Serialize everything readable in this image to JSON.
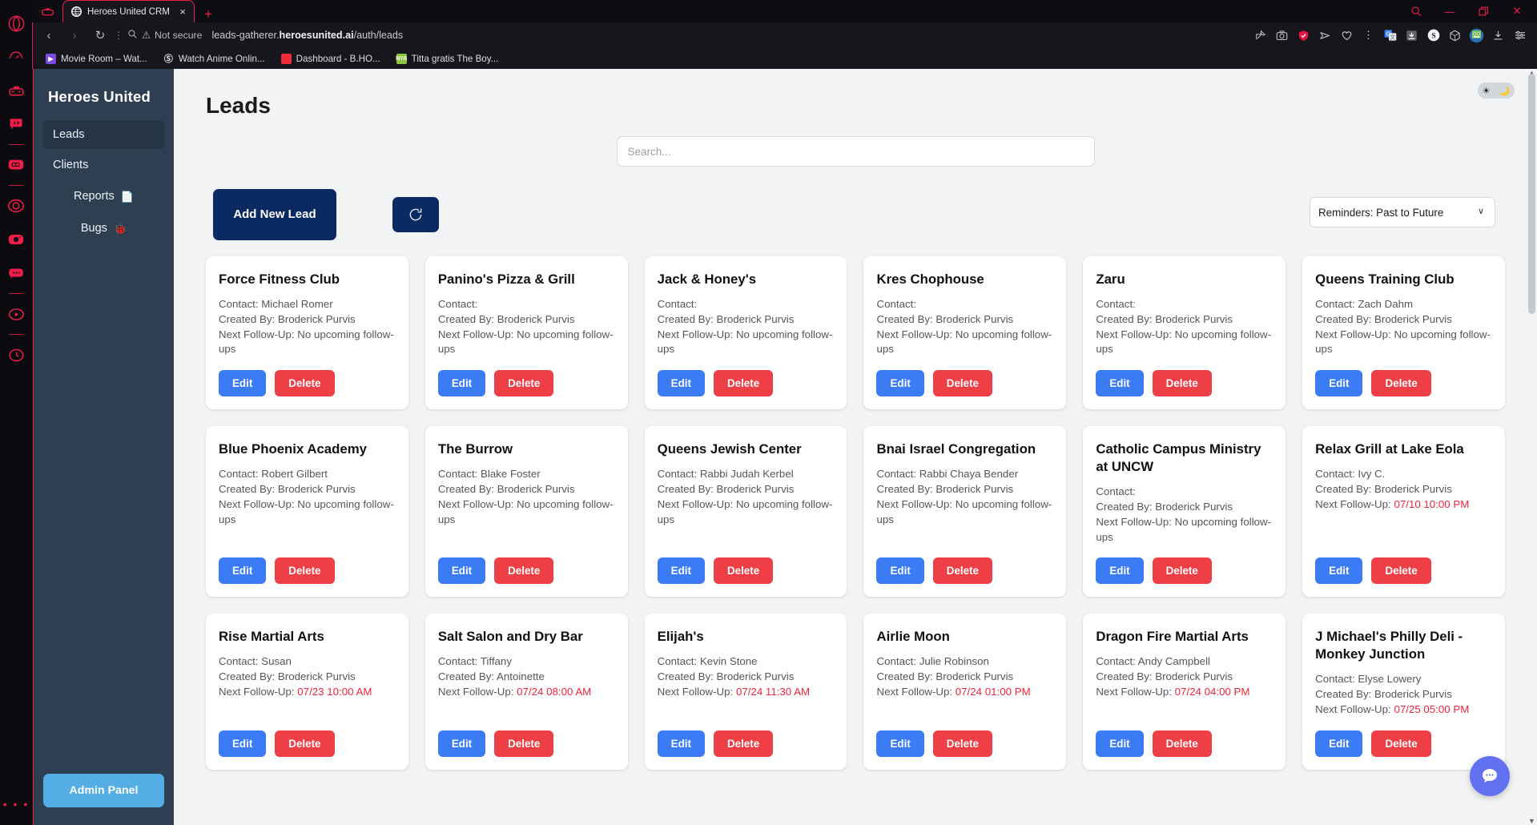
{
  "browser": {
    "tab": {
      "title": "Heroes United CRM",
      "favicon": "globe-icon",
      "close": "×"
    },
    "new_tab": "+",
    "window_controls": {
      "search": "⌕",
      "minimize": "—",
      "restore": "❐",
      "close": "✕"
    },
    "nav": {
      "back": "‹",
      "forward": "›",
      "reload": "↻",
      "vdots": "⋮"
    },
    "security": {
      "label": "Not secure",
      "warn_icon": "⚠",
      "magnifier_icon": "⌕"
    },
    "url": {
      "prefix": "leads-gatherer.",
      "domain": "heroesunited.ai",
      "path": "/auth/leads"
    },
    "toolbar_icons": [
      {
        "name": "pin-edit-icon",
        "glyph": "✎"
      },
      {
        "name": "camera-icon",
        "glyph": "▢"
      },
      {
        "name": "shield-check-icon",
        "glyph": "✔"
      },
      {
        "name": "send-icon",
        "glyph": "➤"
      },
      {
        "name": "heart-icon",
        "glyph": "♡"
      },
      {
        "name": "vertical-dots-icon",
        "glyph": "⋮"
      },
      {
        "name": "google-translate-icon",
        "glyph": "G"
      },
      {
        "name": "download-arrow-icon",
        "glyph": "⬇"
      },
      {
        "name": "shopify-icon",
        "glyph": "S"
      },
      {
        "name": "cube-icon",
        "glyph": "⬡"
      },
      {
        "name": "profile-avatar-icon",
        "glyph": ""
      },
      {
        "name": "downloads-icon",
        "glyph": "⤓"
      },
      {
        "name": "easy-setup-icon",
        "glyph": "☰"
      }
    ],
    "bookmarks": [
      {
        "label": "Movie Room – Wat...",
        "icon": "play-icon",
        "color": "#7b4ae0"
      },
      {
        "label": "Watch Anime Onlin...",
        "icon": "aniwave-icon",
        "color": "#1b1b22"
      },
      {
        "label": "Dashboard - B.HO...",
        "icon": "square-icon",
        "color": "#ee2b39"
      },
      {
        "label": "Titta gratis The Boy...",
        "icon": "nya-icon",
        "color": "#8cc63f"
      }
    ],
    "opera_rail": [
      {
        "name": "opera-logo-icon"
      },
      {
        "name": "speed-dial-icon"
      },
      {
        "name": "gamepad-icon"
      },
      {
        "name": "twitch-icon"
      },
      {
        "name": "separator"
      },
      {
        "name": "chatgpt-icon"
      },
      {
        "name": "separator"
      },
      {
        "name": "whatsapp-icon"
      },
      {
        "name": "instagram-icon"
      },
      {
        "name": "messenger-icon"
      },
      {
        "name": "separator"
      },
      {
        "name": "video-player-icon"
      },
      {
        "name": "separator"
      },
      {
        "name": "history-clock-icon"
      }
    ],
    "rail_more": "• • •"
  },
  "app": {
    "brand": "Heroes United",
    "sidebar": {
      "items": [
        {
          "label": "Leads",
          "icon": "",
          "active": true
        },
        {
          "label": "Clients",
          "icon": "",
          "active": false
        },
        {
          "label": "Reports",
          "icon": "📄",
          "active": false
        },
        {
          "label": "Bugs",
          "icon": "🐞",
          "active": false
        }
      ],
      "admin_button": "Admin Panel"
    },
    "theme_toggle": {
      "light_icon": "☀",
      "dark_icon": "🌙"
    },
    "page_title": "Leads",
    "search": {
      "placeholder": "Search...",
      "value": ""
    },
    "add_lead_label": "Add New Lead",
    "refresh_icon": "↺",
    "sort_select": {
      "selected": "Reminders: Past to Future",
      "caret": "∨",
      "options": [
        "Reminders: Past to Future"
      ]
    },
    "labels": {
      "contact": "Contact:",
      "created_by": "Created By:",
      "next_follow_up": "Next Follow-Up:",
      "no_followups": "No upcoming follow-ups",
      "edit": "Edit",
      "delete": "Delete"
    },
    "chat_fab_icon": "💬",
    "colors": {
      "sidebar_bg": "#2e3f52",
      "admin_btn": "#55ade5",
      "primary_dark": "#0b2a62",
      "edit_blue": "#3b7cf6",
      "delete_red": "#ef3f46",
      "followup_red": "#f0243c",
      "opera_accent": "#f01d4b"
    },
    "leads": [
      {
        "name": "Force Fitness Club",
        "contact": "Michael Romer",
        "created_by": "Broderick Purvis",
        "follow_up": "No upcoming follow-ups",
        "urgent": false
      },
      {
        "name": "Panino's Pizza & Grill",
        "contact": "",
        "created_by": "Broderick Purvis",
        "follow_up": "No upcoming follow-ups",
        "urgent": false
      },
      {
        "name": "Jack & Honey's",
        "contact": "",
        "created_by": "Broderick Purvis",
        "follow_up": "No upcoming follow-ups",
        "urgent": false
      },
      {
        "name": "Kres Chophouse",
        "contact": "",
        "created_by": "Broderick Purvis",
        "follow_up": "No upcoming follow-ups",
        "urgent": false
      },
      {
        "name": "Zaru",
        "contact": "",
        "created_by": "Broderick Purvis",
        "follow_up": "No upcoming follow-ups",
        "urgent": false
      },
      {
        "name": "Queens Training Club",
        "contact": "Zach Dahm",
        "created_by": "Broderick Purvis",
        "follow_up": "No upcoming follow-ups",
        "urgent": false
      },
      {
        "name": "Blue Phoenix Academy",
        "contact": "Robert Gilbert",
        "created_by": "Broderick Purvis",
        "follow_up": "No upcoming follow-ups",
        "urgent": false
      },
      {
        "name": "The Burrow",
        "contact": "Blake Foster",
        "created_by": "Broderick Purvis",
        "follow_up": "No upcoming follow-ups",
        "urgent": false
      },
      {
        "name": "Queens Jewish Center",
        "contact": "Rabbi Judah Kerbel",
        "created_by": "Broderick Purvis",
        "follow_up": "No upcoming follow-ups",
        "urgent": false
      },
      {
        "name": "Bnai Israel Congregation",
        "contact": "Rabbi Chaya Bender",
        "created_by": "Broderick Purvis",
        "follow_up": "No upcoming follow-ups",
        "urgent": false
      },
      {
        "name": "Catholic Campus Ministry at UNCW",
        "contact": "",
        "created_by": "Broderick Purvis",
        "follow_up": "No upcoming follow-ups",
        "urgent": false
      },
      {
        "name": "Relax Grill at Lake Eola",
        "contact": "Ivy C.",
        "created_by": "Broderick Purvis",
        "follow_up": "07/10 10:00 PM",
        "urgent": true
      },
      {
        "name": "Rise Martial Arts",
        "contact": "Susan",
        "created_by": "Broderick Purvis",
        "follow_up": "07/23 10:00 AM",
        "urgent": true
      },
      {
        "name": "Salt Salon and Dry Bar",
        "contact": "Tiffany",
        "created_by": "Antoinette",
        "follow_up": "07/24 08:00 AM",
        "urgent": true
      },
      {
        "name": "Elijah's",
        "contact": "Kevin Stone",
        "created_by": "Broderick Purvis",
        "follow_up": "07/24 11:30 AM",
        "urgent": true
      },
      {
        "name": "Airlie Moon",
        "contact": "Julie Robinson",
        "created_by": "Broderick Purvis",
        "follow_up": "07/24 01:00 PM",
        "urgent": true
      },
      {
        "name": "Dragon Fire Martial Arts",
        "contact": "Andy Campbell",
        "created_by": "Broderick Purvis",
        "follow_up": "07/24 04:00 PM",
        "urgent": true
      },
      {
        "name": "J Michael's Philly Deli - Monkey Junction",
        "contact": "Elyse Lowery",
        "created_by": "Broderick Purvis",
        "follow_up": "07/25 05:00 PM",
        "urgent": true
      }
    ]
  }
}
